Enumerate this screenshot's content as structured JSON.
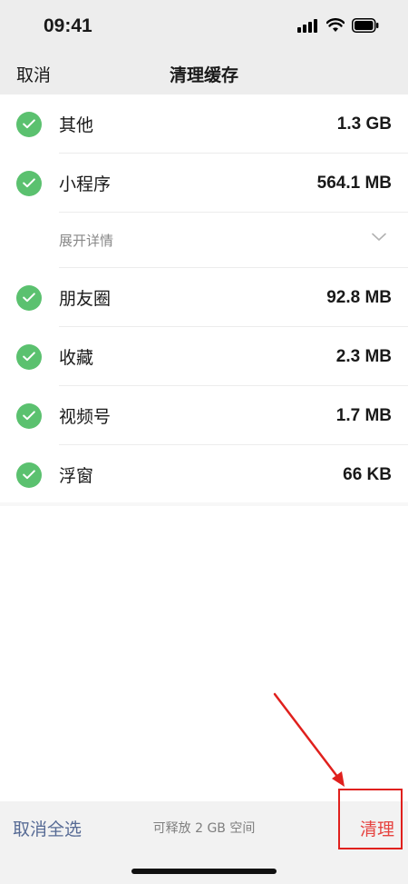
{
  "status_bar": {
    "time": "09:41"
  },
  "nav": {
    "cancel_label": "取消",
    "title": "清理缓存"
  },
  "items": [
    {
      "label": "其他",
      "size": "1.3 GB",
      "checked": true,
      "icon": "check-circle-icon"
    },
    {
      "label": "小程序",
      "size": "564.1 MB",
      "checked": true,
      "icon": "check-circle-icon"
    }
  ],
  "expand": {
    "label": "展开详情",
    "icon": "chevron-down-icon"
  },
  "items2": [
    {
      "label": "朋友圈",
      "size": "92.8 MB",
      "checked": true,
      "icon": "check-circle-icon"
    },
    {
      "label": "收藏",
      "size": "2.3 MB",
      "checked": true,
      "icon": "check-circle-icon"
    },
    {
      "label": "视频号",
      "size": "1.7 MB",
      "checked": true,
      "icon": "check-circle-icon"
    },
    {
      "label": "浮窗",
      "size": "66 KB",
      "checked": true,
      "icon": "check-circle-icon"
    }
  ],
  "bottom_bar": {
    "deselect_label": "取消全选",
    "free_space_text": "可释放 2 GB 空间",
    "clean_label": "清理"
  },
  "colors": {
    "check_green": "#5bc16f",
    "link_blue": "#576b95",
    "danger_red": "#e64340",
    "annotation_red": "#e0201d",
    "nav_bg": "#ededed"
  }
}
